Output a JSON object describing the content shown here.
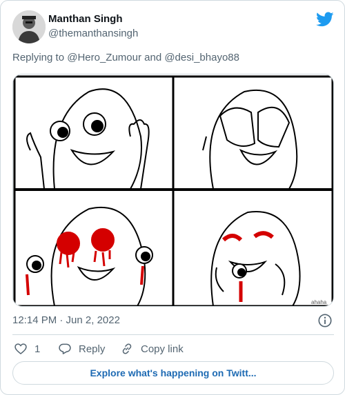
{
  "author": {
    "name": "Manthan Singh",
    "handle": "@themanthansingh",
    "avatar_icon": "avatar-photo"
  },
  "brand": {
    "icon": "twitter-bird-icon",
    "color": "#1d9bf0"
  },
  "reply": {
    "text": "Replying to @Hero_Zumour and @desi_bhayo88"
  },
  "media": {
    "description_icon": "rage-comic-four-panel",
    "watermark": "ahaha"
  },
  "meta": {
    "timestamp": "12:14 PM · Jun 2, 2022",
    "info_icon": "info-icon"
  },
  "actions": {
    "like_count": "1",
    "reply_label": "Reply",
    "copy_link_label": "Copy link"
  },
  "explore": {
    "label": "Explore what's happening on Twitt..."
  },
  "colors": {
    "text": "#0f1419",
    "secondary": "#536471",
    "link": "#1d6ab3",
    "border": "#cfd9de",
    "blood": "#d40000"
  }
}
